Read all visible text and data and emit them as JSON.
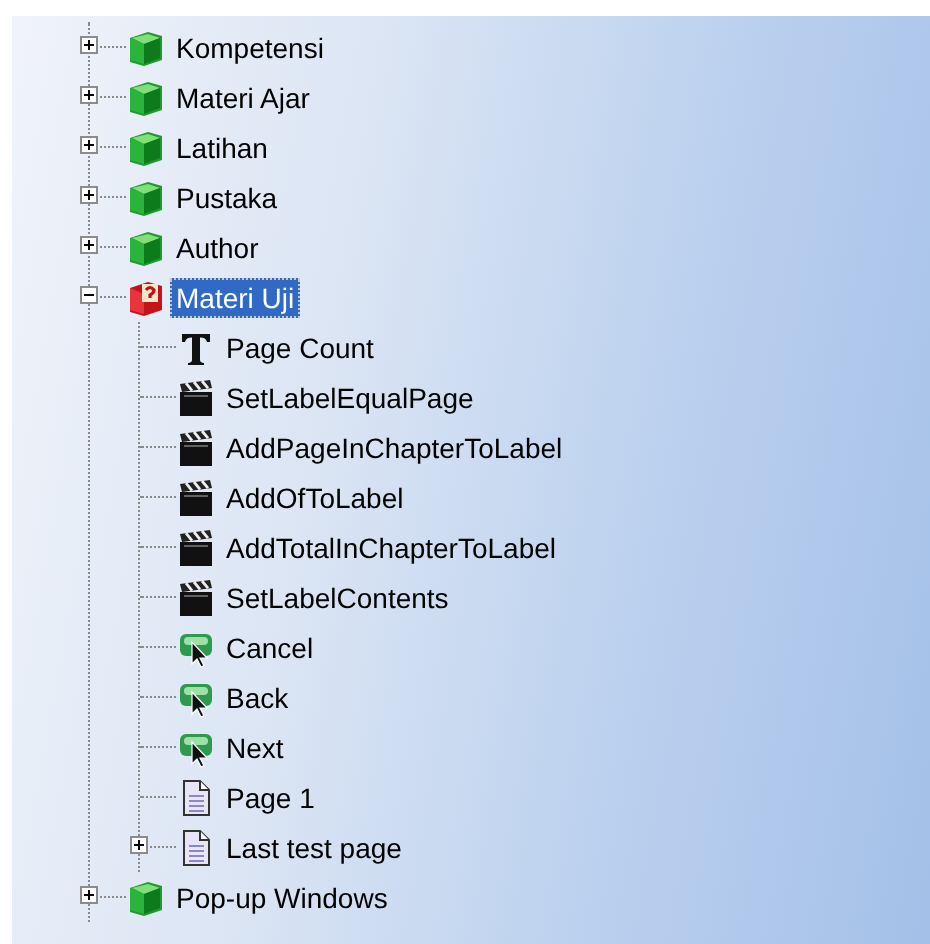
{
  "tree": [
    {
      "label": "Kompetensi",
      "kind": "book",
      "expanded": false,
      "selected": false
    },
    {
      "label": "Materi Ajar",
      "kind": "book",
      "expanded": false,
      "selected": false
    },
    {
      "label": "Latihan",
      "kind": "book",
      "expanded": false,
      "selected": false
    },
    {
      "label": "Pustaka",
      "kind": "book",
      "expanded": false,
      "selected": false
    },
    {
      "label": "Author",
      "kind": "book",
      "expanded": false,
      "selected": false
    },
    {
      "label": "Materi Uji",
      "kind": "question-book",
      "expanded": true,
      "selected": true,
      "children": [
        {
          "label": "Page Count",
          "kind": "text",
          "selected": false
        },
        {
          "label": "SetLabelEqualPage",
          "kind": "action",
          "selected": false
        },
        {
          "label": "AddPageInChapterToLabel",
          "kind": "action",
          "selected": false
        },
        {
          "label": "AddOfToLabel",
          "kind": "action",
          "selected": false
        },
        {
          "label": "AddTotalInChapterToLabel",
          "kind": "action",
          "selected": false
        },
        {
          "label": "SetLabelContents",
          "kind": "action",
          "selected": false
        },
        {
          "label": "Cancel",
          "kind": "button",
          "selected": false
        },
        {
          "label": "Back",
          "kind": "button",
          "selected": false
        },
        {
          "label": "Next",
          "kind": "button",
          "selected": false
        },
        {
          "label": "Page 1",
          "kind": "page",
          "selected": false
        },
        {
          "label": "Last test page",
          "kind": "page",
          "expanded": false,
          "selected": false
        }
      ]
    },
    {
      "label": "Pop-up Windows",
      "kind": "book",
      "expanded": false,
      "selected": false
    }
  ]
}
